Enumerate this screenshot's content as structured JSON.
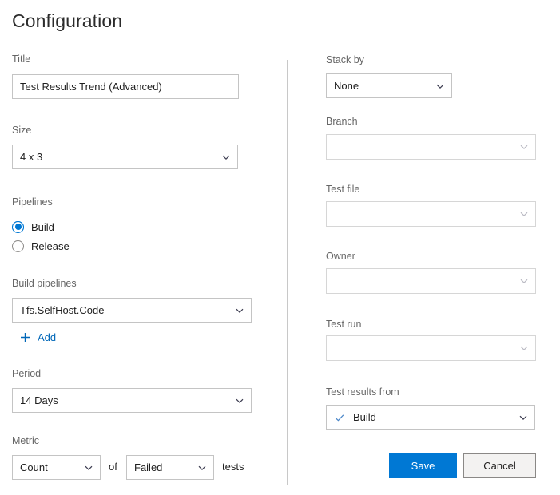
{
  "page": {
    "title": "Configuration"
  },
  "left": {
    "title_field": {
      "label": "Title",
      "value": "Test Results Trend (Advanced)",
      "placeholder": ""
    },
    "size_field": {
      "label": "Size",
      "value": "4 x 3"
    },
    "pipelines_field": {
      "label": "Pipelines",
      "options": [
        {
          "label": "Build",
          "selected": true
        },
        {
          "label": "Release",
          "selected": false
        }
      ]
    },
    "build_pipelines_field": {
      "label": "Build pipelines",
      "value": "Tfs.SelfHost.Code",
      "add_label": "Add"
    },
    "period_field": {
      "label": "Period",
      "value": "14 Days"
    },
    "metric_field": {
      "label": "Metric",
      "aggregate_value": "Count",
      "joiner_text": "of",
      "outcome_value": "Failed",
      "suffix_text": "tests"
    }
  },
  "right": {
    "stack_by_field": {
      "label": "Stack by",
      "value": "None"
    },
    "branch_field": {
      "label": "Branch",
      "value": "",
      "disabled": true
    },
    "test_file_field": {
      "label": "Test file",
      "value": "",
      "disabled": true
    },
    "owner_field": {
      "label": "Owner",
      "value": "",
      "disabled": true
    },
    "test_run_field": {
      "label": "Test run",
      "value": "",
      "disabled": true
    },
    "test_results_from_field": {
      "label": "Test results from",
      "value": "Build"
    },
    "actions": {
      "save_label": "Save",
      "cancel_label": "Cancel"
    }
  },
  "colors": {
    "accent": "#0078d4",
    "link": "#0067b8",
    "label": "#666666",
    "border": "#c4c4c4",
    "border_disabled": "#d6d6d6",
    "divider": "#c8c8c8",
    "text": "#1f1f1f",
    "secondary_button_bg": "#f3f2f1"
  }
}
